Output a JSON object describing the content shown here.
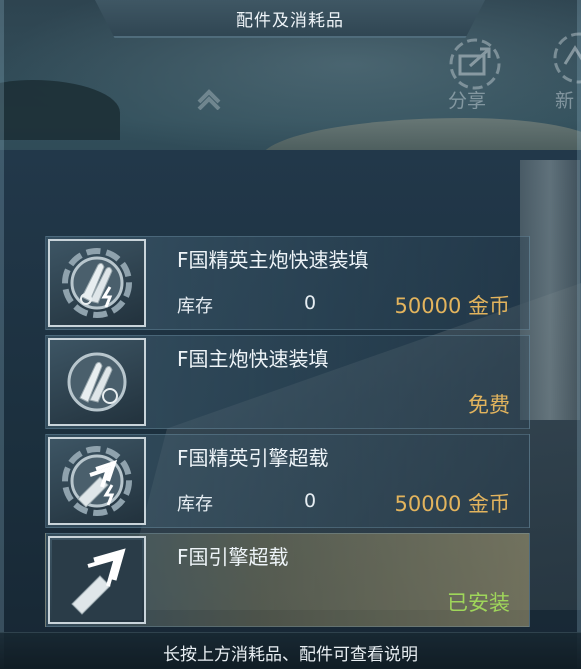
{
  "header": {
    "title": "配件及消耗品"
  },
  "top_actions": {
    "share_label": "分享",
    "share_icon": "share-icon",
    "new_label": "新",
    "new_icon": "new-icon"
  },
  "items": [
    {
      "name": "F国精英主炮快速装填",
      "icon": "elite-main-gun-reload-icon",
      "stock_label": "库存",
      "stock_value": "0",
      "price": "50000 金币",
      "status": "price"
    },
    {
      "name": "F国主炮快速装填",
      "icon": "main-gun-reload-icon",
      "stock_label": "",
      "stock_value": "",
      "price": "免费",
      "status": "free"
    },
    {
      "name": "F国精英引擎超载",
      "icon": "elite-engine-overload-icon",
      "stock_label": "库存",
      "stock_value": "0",
      "price": "50000 金币",
      "status": "price"
    },
    {
      "name": "F国引擎超载",
      "icon": "engine-overload-icon",
      "stock_label": "",
      "stock_value": "",
      "price": "已安装",
      "status": "installed"
    }
  ],
  "footer": {
    "hint": "长按上方消耗品、配件可查看说明"
  },
  "colors": {
    "gold_price": "#e3b45d",
    "installed_green": "#9fd65a",
    "panel_border": "#c9d4da"
  }
}
